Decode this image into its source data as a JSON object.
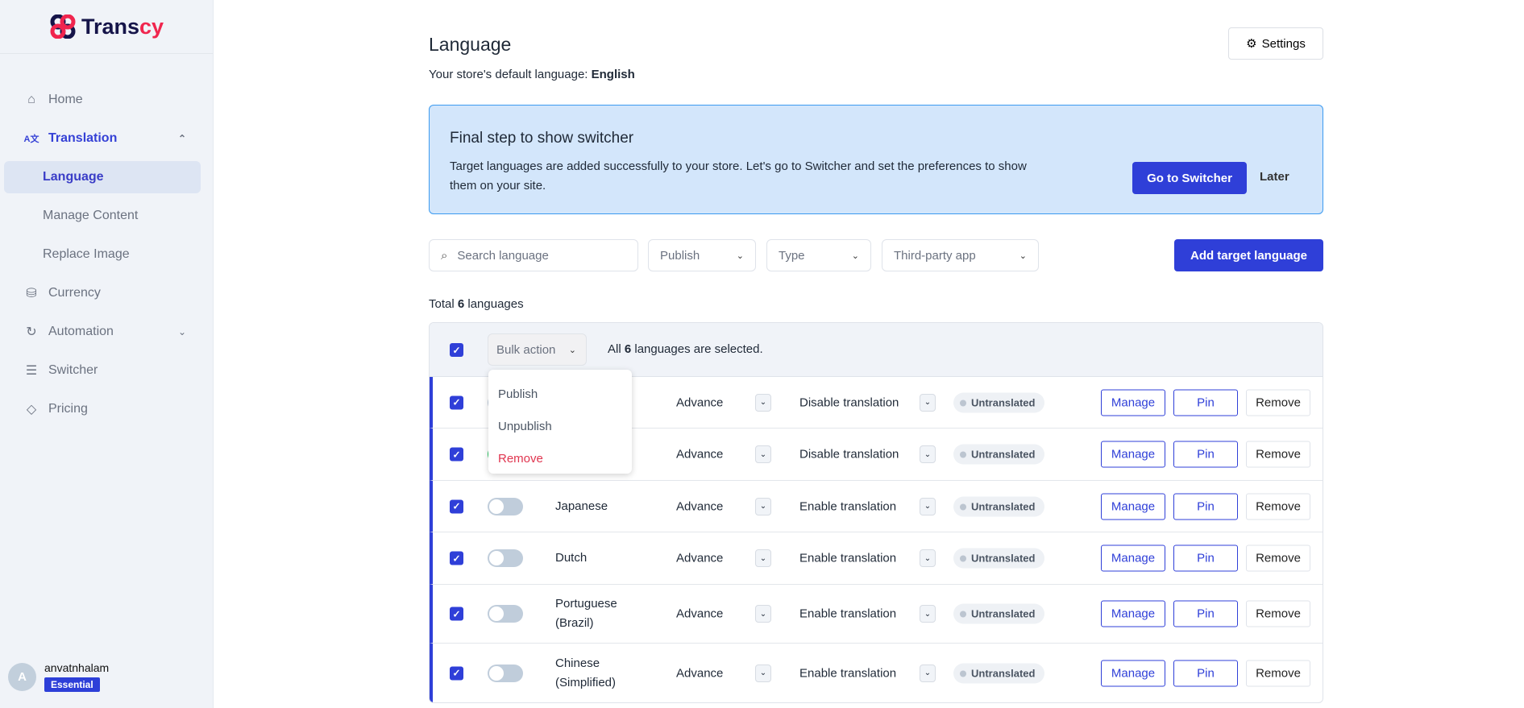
{
  "brand": {
    "name_main": "Trans",
    "name_accent": "cy"
  },
  "sidebar": {
    "items": [
      {
        "label": "Home",
        "icon": "home-icon"
      },
      {
        "label": "Translation",
        "icon": "translate-icon",
        "expanded": true
      },
      {
        "label": "Language",
        "sub": true,
        "selected": true
      },
      {
        "label": "Manage Content",
        "sub": true
      },
      {
        "label": "Replace Image",
        "sub": true
      },
      {
        "label": "Currency",
        "icon": "coin-icon"
      },
      {
        "label": "Automation",
        "icon": "auto-translate-icon"
      },
      {
        "label": "Switcher",
        "icon": "sliders-icon"
      },
      {
        "label": "Pricing",
        "icon": "tag-icon"
      }
    ],
    "user": {
      "initial": "A",
      "name": "anvatnhalam",
      "plan": "Essential"
    }
  },
  "header": {
    "title": "Language",
    "default_label": "Your store's default language: ",
    "default_value": "English",
    "settings": "Settings"
  },
  "banner": {
    "title": "Final step to show switcher",
    "text": "Target languages are added successfully to your store. Let's go to Switcher and set the preferences to show them on your site.",
    "primary": "Go to Switcher",
    "secondary": "Later"
  },
  "filters": {
    "search_placeholder": "Search language",
    "publish": "Publish",
    "type": "Type",
    "third_party": "Third-party app",
    "add": "Add target language"
  },
  "total": {
    "prefix": "Total ",
    "count": "6",
    "suffix": " languages"
  },
  "table": {
    "bulk_action": "Bulk action",
    "selected_prefix": "All ",
    "selected_count": "6",
    "selected_suffix": " languages are selected.",
    "rows": [
      {
        "name": "",
        "published": false,
        "type": "Advance",
        "translation": "Disable translation",
        "status": "Untranslated"
      },
      {
        "name": "",
        "published": true,
        "type": "Advance",
        "translation": "Disable translation",
        "status": "Untranslated"
      },
      {
        "name": "Japanese",
        "published": false,
        "type": "Advance",
        "translation": "Enable translation",
        "status": "Untranslated"
      },
      {
        "name": "Dutch",
        "published": false,
        "type": "Advance",
        "translation": "Enable translation",
        "status": "Untranslated"
      },
      {
        "name": "Portuguese (Brazil)",
        "published": false,
        "type": "Advance",
        "translation": "Enable translation",
        "status": "Untranslated"
      },
      {
        "name": "Chinese (Simplified)",
        "published": false,
        "type": "Advance",
        "translation": "Enable translation",
        "status": "Untranslated"
      }
    ],
    "actions": {
      "manage": "Manage",
      "pin": "Pin",
      "remove": "Remove"
    }
  },
  "bulk_menu": {
    "items": [
      "Publish",
      "Unpublish",
      "Remove"
    ]
  },
  "colors": {
    "primary": "#2f3fd8",
    "banner_bg": "#d3e6fb",
    "danger": "#e0354f",
    "published": "#22c55e"
  }
}
